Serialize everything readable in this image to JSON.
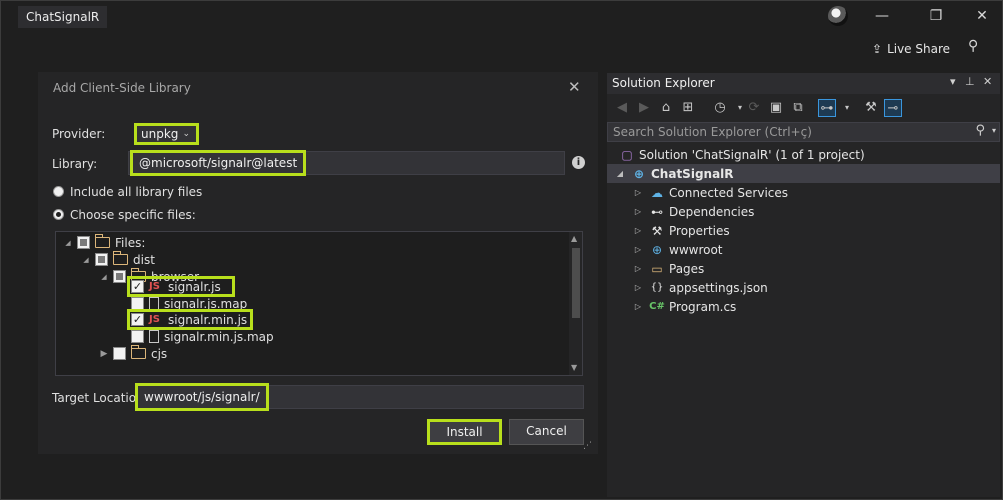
{
  "window": {
    "title": "ChatSignalR",
    "live_share_label": "Live Share",
    "minimize_glyph": "—",
    "restore_glyph": "❐",
    "close_glyph": "✕"
  },
  "dialog": {
    "title": "Add Client-Side Library",
    "provider_label": "Provider:",
    "provider_value": "unpkg",
    "library_label": "Library:",
    "library_value": "@microsoft/signalr@latest",
    "include_all_label": "Include all library files",
    "choose_specific_label": "Choose specific files:",
    "selected_option": "choose_specific",
    "tree": [
      {
        "label": "Files:",
        "level": 0,
        "type": "folder",
        "check": "partial",
        "expanded": true
      },
      {
        "label": "dist",
        "level": 1,
        "type": "folder",
        "check": "partial",
        "expanded": true
      },
      {
        "label": "browser",
        "level": 2,
        "type": "folder",
        "check": "partial",
        "expanded": true
      },
      {
        "label": "signalr.js",
        "level": 3,
        "type": "js",
        "check": "checked",
        "highlight": true
      },
      {
        "label": "signalr.js.map",
        "level": 3,
        "type": "file",
        "check": "unchecked"
      },
      {
        "label": "signalr.min.js",
        "level": 3,
        "type": "js",
        "check": "checked",
        "highlight": true
      },
      {
        "label": "signalr.min.js.map",
        "level": 3,
        "type": "file",
        "check": "unchecked"
      },
      {
        "label": "cjs",
        "level": 2,
        "type": "folder",
        "check": "unchecked",
        "expanded": false
      }
    ],
    "target_label": "Target Location:",
    "target_value": "wwwroot/js/signalr/",
    "install_label": "Install",
    "cancel_label": "Cancel"
  },
  "solution_explorer": {
    "title": "Solution Explorer",
    "search_placeholder": "Search Solution Explorer (Ctrl+ç)",
    "solution_label": "Solution 'ChatSignalR' (1 of 1 project)",
    "project_label": "ChatSignalR",
    "items": [
      {
        "label": "Connected Services",
        "icon": "cloud-icon",
        "color": "#5fb3e6"
      },
      {
        "label": "Dependencies",
        "icon": "dependencies-icon",
        "color": "#d0d0d0"
      },
      {
        "label": "Properties",
        "icon": "wrench-icon",
        "color": "#d0d0d0"
      },
      {
        "label": "wwwroot",
        "icon": "globe-icon",
        "color": "#5fb3e6"
      },
      {
        "label": "Pages",
        "icon": "folder-icon",
        "color": "#dcb67a"
      },
      {
        "label": "appsettings.json",
        "icon": "json-icon",
        "color": "#d0d0d0"
      },
      {
        "label": "Program.cs",
        "icon": "csharp-icon",
        "color": "#68c468"
      }
    ]
  },
  "colors": {
    "highlight": "#b8df1c",
    "background": "#1f1f1f",
    "panel": "#252526"
  }
}
